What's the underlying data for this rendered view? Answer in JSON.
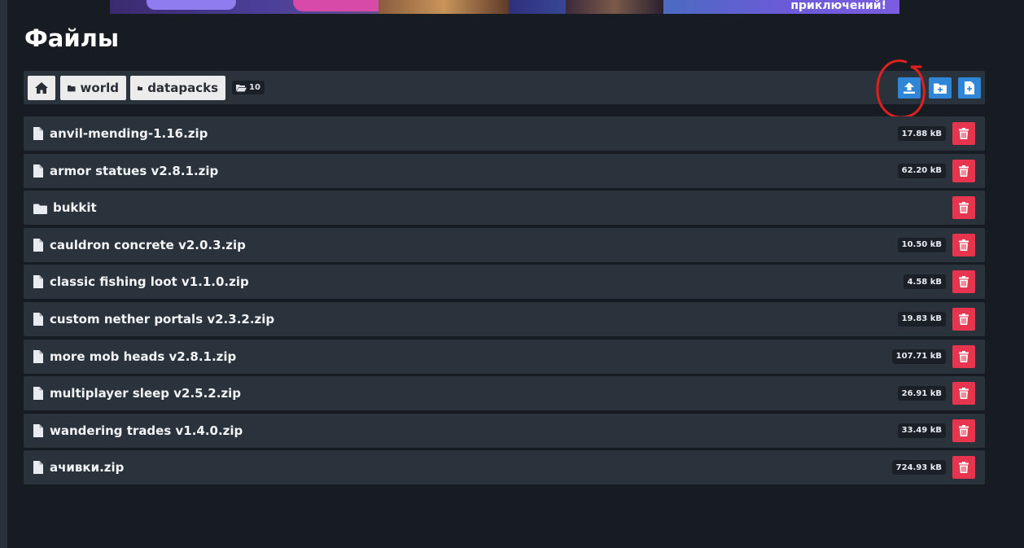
{
  "banner": {
    "text": "приключений!"
  },
  "page": {
    "title": "Файлы"
  },
  "breadcrumb": {
    "home_icon": "home-icon",
    "items": [
      {
        "label": "world",
        "icon": "folder-icon"
      },
      {
        "label": "datapacks",
        "icon": "folder-icon"
      }
    ],
    "count": "10"
  },
  "toolbar": {
    "actions": [
      {
        "icon": "upload-icon",
        "color": "#2f86d6"
      },
      {
        "icon": "new-folder-icon",
        "color": "#2f86d6"
      },
      {
        "icon": "new-file-icon",
        "color": "#2f86d6"
      }
    ],
    "annotation_color": "#e02020"
  },
  "files": [
    {
      "name": "anvil-mending-1.16.zip",
      "type": "file",
      "size": "17.88 kB"
    },
    {
      "name": "armor statues v2.8.1.zip",
      "type": "file",
      "size": "62.20 kB"
    },
    {
      "name": "bukkit",
      "type": "folder",
      "size": ""
    },
    {
      "name": "cauldron concrete v2.0.3.zip",
      "type": "file",
      "size": "10.50 kB"
    },
    {
      "name": "classic fishing loot v1.1.0.zip",
      "type": "file",
      "size": "4.58 kB"
    },
    {
      "name": "custom nether portals v2.3.2.zip",
      "type": "file",
      "size": "19.83 kB"
    },
    {
      "name": "more mob heads v2.8.1.zip",
      "type": "file",
      "size": "107.71 kB"
    },
    {
      "name": "multiplayer sleep v2.5.2.zip",
      "type": "file",
      "size": "26.91 kB"
    },
    {
      "name": "wandering trades v1.4.0.zip",
      "type": "file",
      "size": "33.49 kB"
    },
    {
      "name": "ачивки.zip",
      "type": "file",
      "size": "724.93 kB"
    }
  ],
  "colors": {
    "background": "#171b22",
    "row": "#2a323b",
    "delete": "#e8354f",
    "accent": "#2f86d6"
  }
}
